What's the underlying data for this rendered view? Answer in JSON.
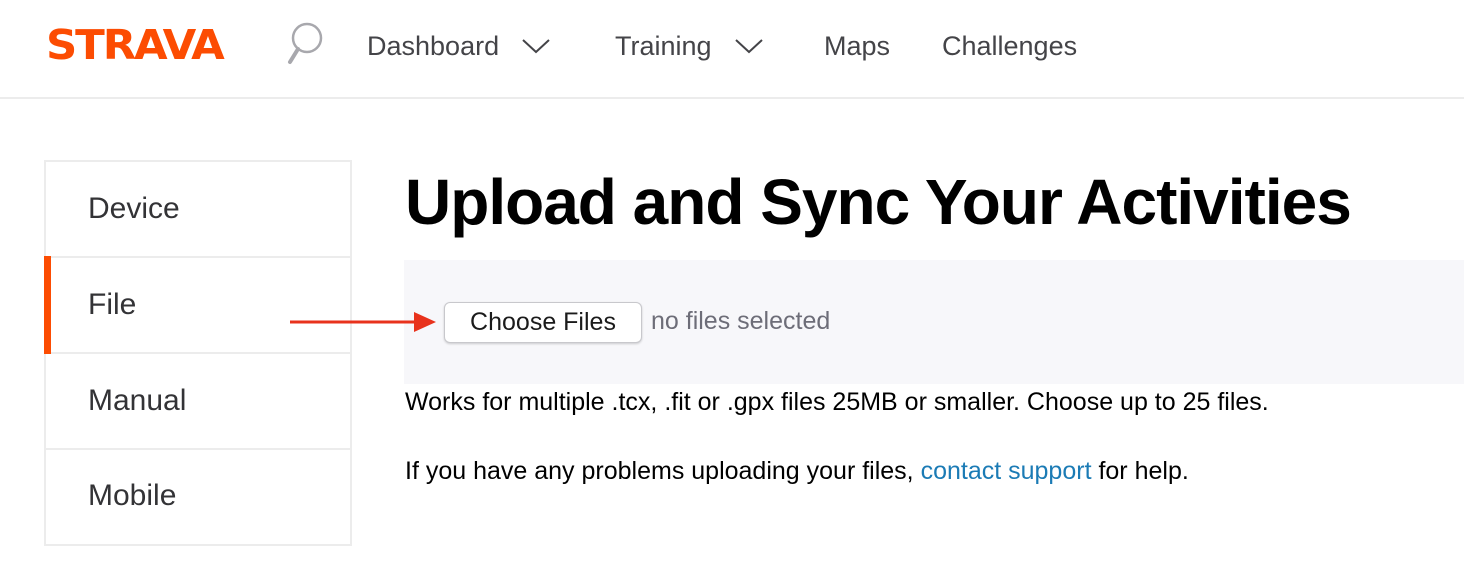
{
  "brand": {
    "logo_text": "STRAVA",
    "accent_color": "#fc4c02"
  },
  "topnav": {
    "search_icon": "search-icon",
    "items": [
      {
        "label": "Dashboard",
        "has_dropdown": true
      },
      {
        "label": "Training",
        "has_dropdown": true
      },
      {
        "label": "Maps",
        "has_dropdown": false
      },
      {
        "label": "Challenges",
        "has_dropdown": false
      }
    ]
  },
  "sidebar": {
    "items": [
      {
        "label": "Device",
        "active": false
      },
      {
        "label": "File",
        "active": true
      },
      {
        "label": "Manual",
        "active": false
      },
      {
        "label": "Mobile",
        "active": false
      }
    ]
  },
  "main": {
    "title": "Upload and Sync Your Activities",
    "file_input": {
      "button_label": "Choose Files",
      "status": "no files selected"
    },
    "works_text": "Works for multiple .tcx, .fit or .gpx files 25MB or smaller. Choose up to 25 files.",
    "problems_prefix": "If you have any problems uploading your files, ",
    "problems_link": "contact support",
    "problems_suffix": " for help.",
    "link_color": "#1b7bb5"
  },
  "annotation": {
    "arrow_color": "#e8321c"
  }
}
